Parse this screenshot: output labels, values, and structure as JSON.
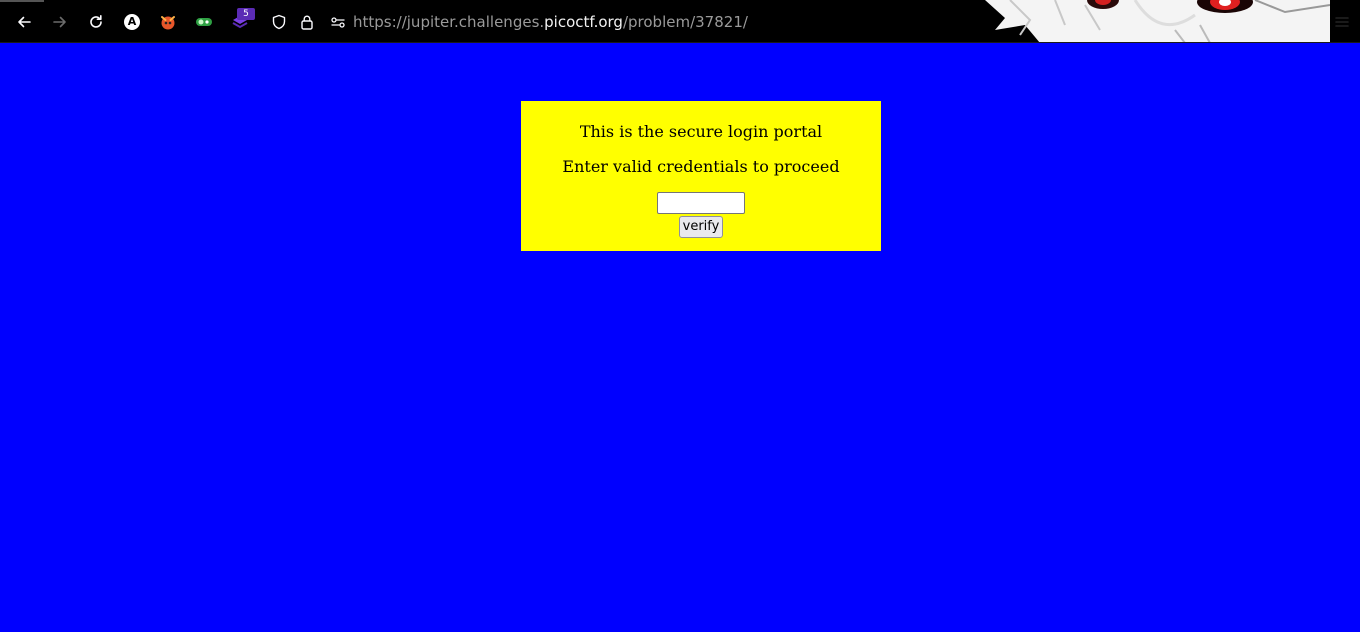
{
  "browser": {
    "url_prefix": "https://jupiter.challenges.",
    "url_host": "picoctf.org",
    "url_path": "/problem/37821/",
    "extension_badge": "5",
    "extension_a_letter": "A",
    "icons": [
      "back-arrow-icon",
      "forward-arrow-icon",
      "reload-icon",
      "extension-a-icon",
      "extension-fox-icon",
      "extension-green-icon",
      "extension-purple-icon",
      "shield-icon",
      "lock-icon",
      "permissions-icon",
      "menu-icon"
    ]
  },
  "portal": {
    "title": "This is the secure login portal",
    "subtitle": "Enter valid credentials to proceed",
    "password_value": "",
    "verify_label": "verify"
  },
  "colors": {
    "page_background": "#0000ff",
    "portal_background": "#ffff00",
    "toolbar_background": "#000000"
  }
}
